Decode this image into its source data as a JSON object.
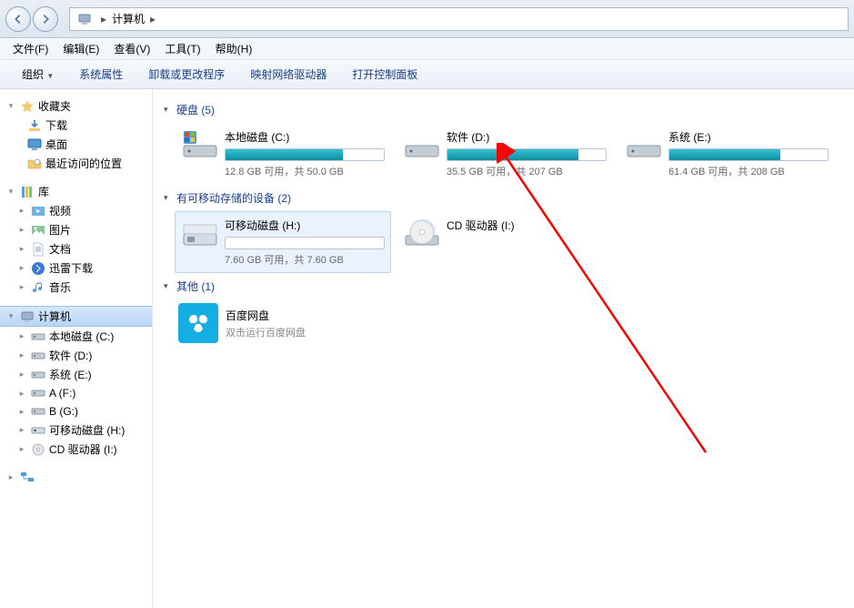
{
  "addressbar": {
    "root": "计算机"
  },
  "menu": {
    "file": "文件(F)",
    "edit": "编辑(E)",
    "view": "查看(V)",
    "tools": "工具(T)",
    "help": "帮助(H)"
  },
  "toolbar": {
    "organize": "组织",
    "sysprop": "系统属性",
    "uninstall": "卸载或更改程序",
    "mapdrive": "映射网络驱动器",
    "openctl": "打开控制面板"
  },
  "sidebar": {
    "favorites": {
      "label": "收藏夹",
      "items": {
        "downloads": "下载",
        "desktop": "桌面",
        "recent": "最近访问的位置"
      }
    },
    "libraries": {
      "label": "库",
      "items": {
        "videos": "视频",
        "pictures": "图片",
        "documents": "文档",
        "xunlei": "迅雷下载",
        "music": "音乐"
      }
    },
    "computer": {
      "label": "计算机",
      "items": {
        "c": "本地磁盘 (C:)",
        "d": "软件 (D:)",
        "e": "系统 (E:)",
        "f": "A (F:)",
        "g": "B (G:)",
        "h": "可移动磁盘 (H:)",
        "i": "CD 驱动器 (I:)"
      }
    }
  },
  "sections": {
    "hdd": {
      "title": "硬盘 (5)"
    },
    "removable": {
      "title": "有可移动存储的设备 (2)"
    },
    "other": {
      "title": "其他 (1)"
    }
  },
  "drives": {
    "c": {
      "name": "本地磁盘 (C:)",
      "sub": "12.8 GB 可用，共 50.0 GB",
      "pct": 74,
      "color": "#18a7b8"
    },
    "d": {
      "name": "软件 (D:)",
      "sub": "35.5 GB 可用，共 207 GB",
      "pct": 83,
      "color": "#18a7b8"
    },
    "e": {
      "name": "系统 (E:)",
      "sub": "61.4 GB 可用，共 208 GB",
      "pct": 70,
      "color": "#18a7b8"
    },
    "h": {
      "name": "可移动磁盘 (H:)",
      "sub": "7.60 GB 可用，共 7.60 GB",
      "pct": 0,
      "color": "#18a7b8"
    },
    "cd": {
      "name": "CD 驱动器 (I:)"
    }
  },
  "other": {
    "baidu": {
      "name": "百度网盘",
      "desc": "双击运行百度网盘"
    }
  }
}
